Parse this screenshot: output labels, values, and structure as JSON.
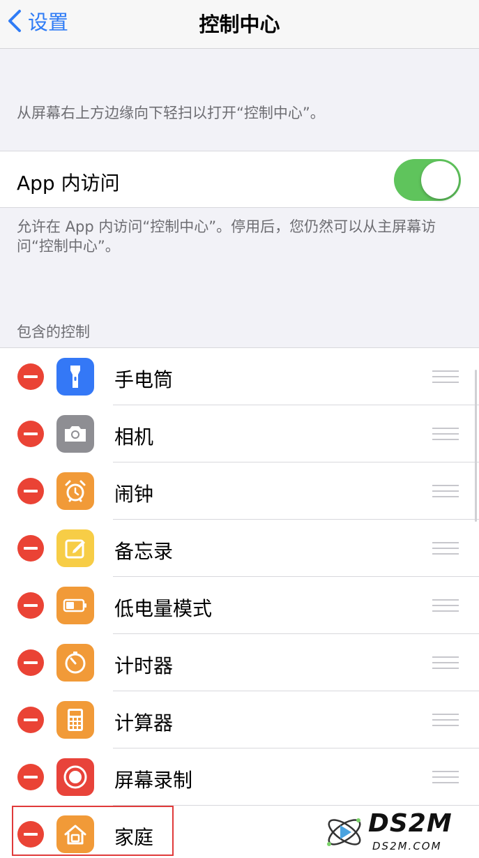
{
  "nav": {
    "back_label": "设置",
    "title": "控制中心"
  },
  "descriptions": {
    "swipe_hint": "从屏幕右上方边缘向下轻扫以打开“控制中心”。",
    "access_footer": "允许在 App 内访问“控制中心”。停用后，您仍然可以从主屏幕访问“控制中心”。"
  },
  "access_within_apps": {
    "label": "App 内访问",
    "enabled": true
  },
  "included_controls": {
    "header": "包含的控制",
    "items": [
      {
        "label": "手电筒",
        "icon": "flashlight-icon",
        "color": "#3478f6"
      },
      {
        "label": "相机",
        "icon": "camera-icon",
        "color": "#8e8e93"
      },
      {
        "label": "闹钟",
        "icon": "alarm-clock-icon",
        "color": "#f19a38"
      },
      {
        "label": "备忘录",
        "icon": "notes-icon",
        "color": "#f7cd46"
      },
      {
        "label": "低电量模式",
        "icon": "battery-icon",
        "color": "#f19a38"
      },
      {
        "label": "计时器",
        "icon": "timer-icon",
        "color": "#f19a38"
      },
      {
        "label": "计算器",
        "icon": "calculator-icon",
        "color": "#f19a38"
      },
      {
        "label": "屏幕录制",
        "icon": "screen-record-icon",
        "color": "#e8433a"
      },
      {
        "label": "家庭",
        "icon": "home-icon",
        "color": "#f19a38"
      }
    ]
  },
  "watermark": {
    "title": "DS2M",
    "subtitle": "DS2M.COM"
  },
  "colors": {
    "accent": "#2f7cf6",
    "toggle_on": "#5fc45c",
    "remove": "#ea4335",
    "highlight": "#e03a3a"
  }
}
